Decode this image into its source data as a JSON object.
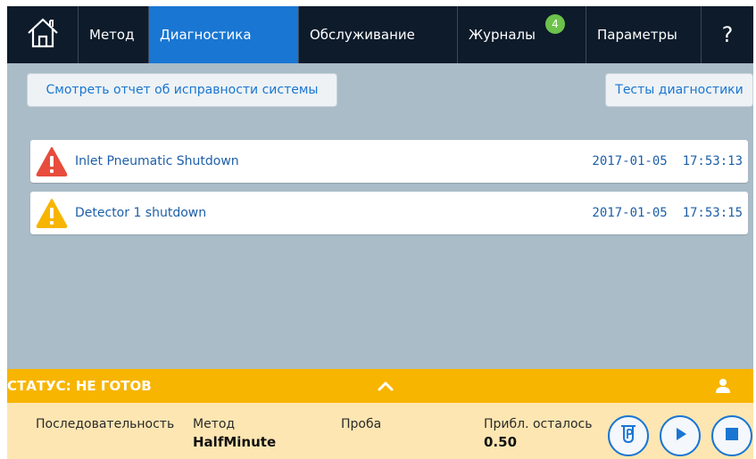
{
  "nav": {
    "home_icon": "home-icon",
    "tabs": [
      {
        "label": "Метод"
      },
      {
        "label": "Диагностика"
      },
      {
        "label": "Обслуживание"
      },
      {
        "label": "Журналы",
        "badge": "4"
      },
      {
        "label": "Параметры"
      }
    ],
    "help": "?"
  },
  "actions": {
    "health_report": "Смотреть отчет об исправности системы",
    "diag_tests": "Тесты диагностики"
  },
  "events": [
    {
      "severity": "error",
      "icon": "error-triangle-icon",
      "message": "Inlet Pneumatic Shutdown",
      "timestamp": "2017-01-05  17:53:13"
    },
    {
      "severity": "warning",
      "icon": "warning-triangle-icon",
      "message": "Detector 1 shutdown",
      "timestamp": "2017-01-05  17:53:15"
    }
  ],
  "status": {
    "text": "СТАТУС: НЕ ГОТОВ",
    "expand_icon": "chevron-up-icon",
    "user_icon": "user-icon"
  },
  "info": {
    "sequence_label": "Последовательность",
    "method_label": "Метод",
    "method_value": "HalfMinute",
    "sample_label": "Проба",
    "remaining_label": "Прибл. осталось",
    "remaining_value": "0.50"
  },
  "controls": {
    "vial_icon": "vial-icon",
    "play_icon": "play-icon",
    "stop_icon": "stop-icon"
  },
  "colors": {
    "nav_bg": "#0d1b2a",
    "active_tab": "#1976d2",
    "error": "#e74c3c",
    "warning": "#f7b500",
    "status_bar": "#f7b500",
    "badge": "#6cc24a"
  }
}
